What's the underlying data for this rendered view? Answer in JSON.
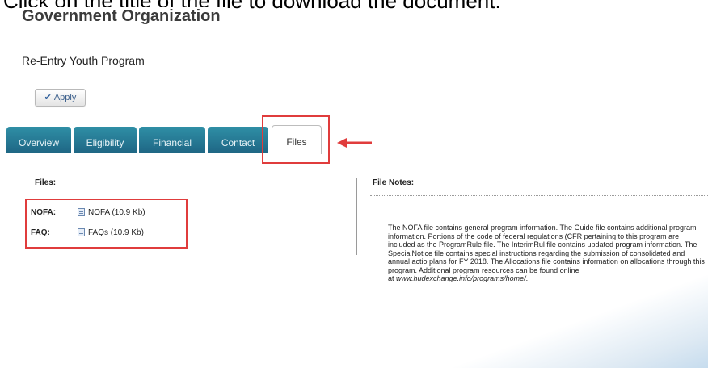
{
  "instruction": "Click on the title of the file to download the document.",
  "header": {
    "org_title": "Government Organization",
    "program_name": "Re-Entry Youth Program",
    "apply_label": "Apply"
  },
  "tabs": [
    {
      "label": "Overview"
    },
    {
      "label": "Eligibility"
    },
    {
      "label": "Financial"
    },
    {
      "label": "Contact"
    },
    {
      "label": "Files"
    }
  ],
  "files_panel": {
    "title": "Files:",
    "rows": [
      {
        "label": "NOFA:",
        "link": "NOFA (10.9 Kb)"
      },
      {
        "label": "FAQ:",
        "link": "FAQs (10.9 Kb)"
      }
    ]
  },
  "notes_panel": {
    "title": "File Notes:",
    "text": "The NOFA file contains general program information. The Guide file contains additional program information. Portions of the code of federal regulations (CFR pertaining to this program are included as the ProgramRule file. The InterimRul file contains updated program information. The SpecialNotice file contains special instructions regarding the submission of consolidated and annual actio plans for FY 2018. The Allocations file contains information on allocations through this program. Additional program resources can be found online",
    "link_prefix": "at ",
    "link_text": "www.hudexchange.info/programs/home/",
    "link_suffix": "."
  },
  "colors": {
    "tab_bg": "#2a7f99",
    "highlight": "#e03c3c"
  }
}
